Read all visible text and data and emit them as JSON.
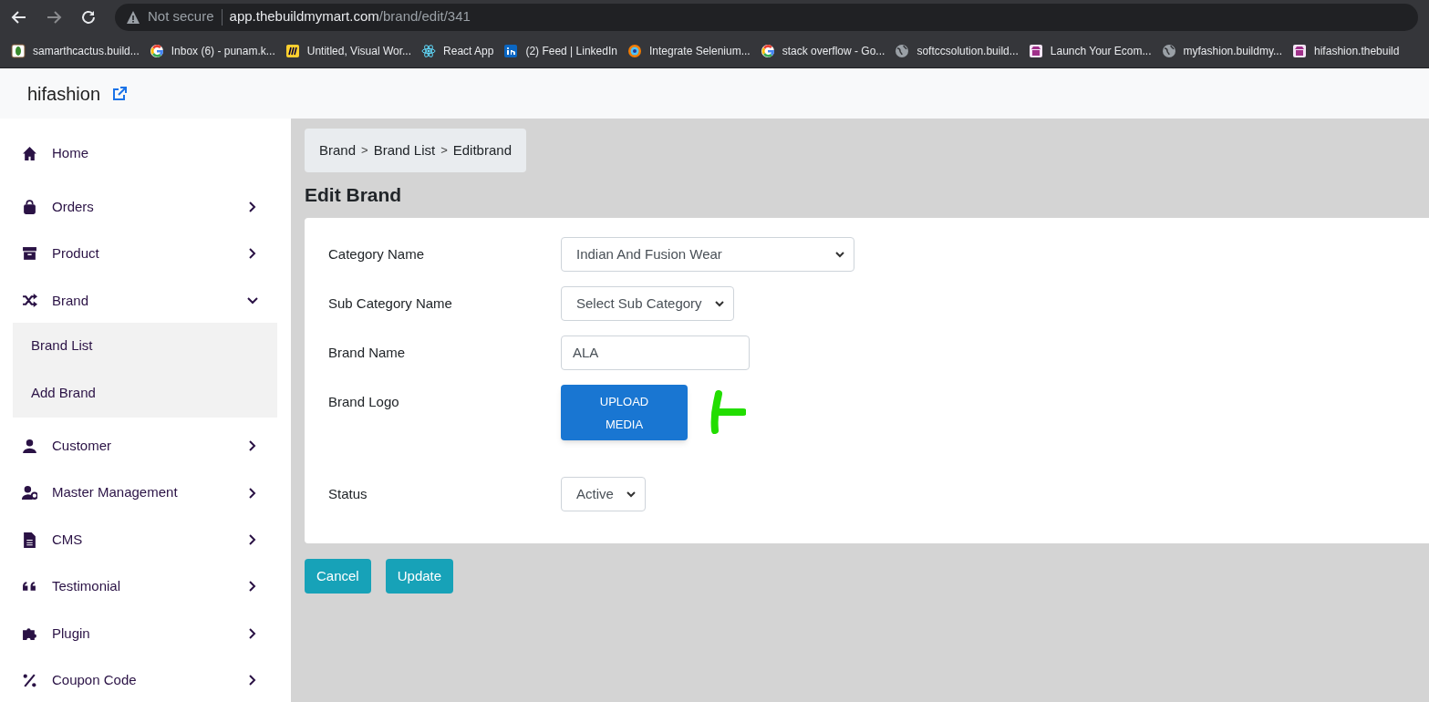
{
  "browser": {
    "security": "Not secure",
    "url_host": "app.thebuildmymart.com",
    "url_path": "/brand/edit/341"
  },
  "bookmarks": [
    {
      "label": "samarthcactus.build..."
    },
    {
      "label": "Inbox (6) - punam.k..."
    },
    {
      "label": "Untitled, Visual Wor..."
    },
    {
      "label": "React App"
    },
    {
      "label": "(2) Feed | LinkedIn"
    },
    {
      "label": "Integrate Selenium..."
    },
    {
      "label": "stack overflow - Go..."
    },
    {
      "label": "softccsolution.build..."
    },
    {
      "label": "Launch Your Ecom..."
    },
    {
      "label": "myfashion.buildmy..."
    },
    {
      "label": "hifashion.thebuild"
    }
  ],
  "app": {
    "brand": "hifashion"
  },
  "sidebar": {
    "items": [
      {
        "label": "Home",
        "kind": "link"
      },
      {
        "label": "Orders",
        "kind": "group",
        "expanded": false
      },
      {
        "label": "Product",
        "kind": "group",
        "expanded": false
      },
      {
        "label": "Brand",
        "kind": "group",
        "expanded": true,
        "children": [
          {
            "label": "Brand List"
          },
          {
            "label": "Add Brand"
          }
        ]
      },
      {
        "label": "Customer",
        "kind": "group",
        "expanded": false
      },
      {
        "label": "Master Management",
        "kind": "group",
        "expanded": false
      },
      {
        "label": "CMS",
        "kind": "group",
        "expanded": false
      },
      {
        "label": "Testimonial",
        "kind": "group",
        "expanded": false
      },
      {
        "label": "Plugin",
        "kind": "group",
        "expanded": false
      },
      {
        "label": "Coupon Code",
        "kind": "group",
        "expanded": false
      }
    ]
  },
  "breadcrumb": [
    {
      "kind": "link",
      "label": "Brand"
    },
    {
      "kind": "separator",
      "label": ">"
    },
    {
      "kind": "link",
      "label": "Brand List"
    },
    {
      "kind": "separator",
      "label": ">"
    },
    {
      "kind": "link",
      "label": "Editbrand"
    }
  ],
  "page_title": "Edit Brand",
  "form": {
    "fields": [
      {
        "label": "Category Name",
        "kind": "select",
        "value": "Indian And Fusion Wear"
      },
      {
        "label": "Sub Category Name",
        "kind": "select",
        "value": "Select Sub Category"
      },
      {
        "label": "Brand Name",
        "kind": "input",
        "value": "ALA"
      },
      {
        "label": "Brand Logo",
        "kind": "upload",
        "button": "UPLOAD MEDIA"
      },
      {
        "label": "Status",
        "kind": "select",
        "value": "Active"
      }
    ]
  },
  "actions": [
    "Cancel",
    "Update"
  ]
}
